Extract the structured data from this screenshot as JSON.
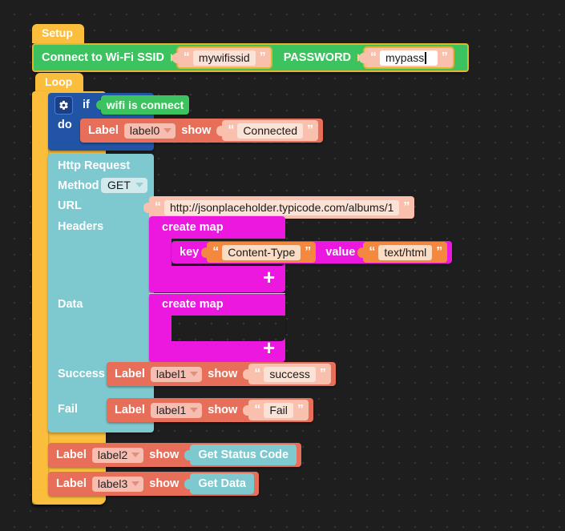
{
  "editor": {
    "background_color": "#1e1e1e",
    "grid_dot_color": "#3a3a3a"
  },
  "setup": {
    "tab_label": "Setup",
    "statement_label": "Connect to Wi-Fi SSID",
    "ssid_value": "mywifissid",
    "password_label": "PASSWORD",
    "password_value": "mypass",
    "color": "#3cc35f"
  },
  "loop": {
    "tab_label": "Loop",
    "color": "#fbbe3c"
  },
  "if_block": {
    "gear_icon": "gear-icon",
    "if_label": "if",
    "do_label": "do",
    "condition": "wifi is connect",
    "color": "#2254a5",
    "body": {
      "label_word": "Label",
      "label_target": "label0",
      "show_word": "show",
      "text_value": "Connected"
    }
  },
  "http_request": {
    "title": "Http Request",
    "color": "#7dc9cf",
    "rows": {
      "method_label": "Method",
      "method_value": "GET",
      "url_label": "URL",
      "url_value": "http://jsonplaceholder.typicode.com/albums/1",
      "headers_label": "Headers",
      "data_label": "Data",
      "success_label": "Success",
      "fail_label": "Fail"
    },
    "headers_map": {
      "create_map_label": "create map",
      "plus_label": "+",
      "entry": {
        "key_label": "key",
        "key_value": "Content-Type",
        "value_label": "value",
        "value_value": "text/html"
      }
    },
    "data_map": {
      "create_map_label": "create map",
      "plus_label": "+"
    },
    "success_statement": {
      "label_word": "Label",
      "label_target": "label1",
      "show_word": "show",
      "text_value": "success"
    },
    "fail_statement": {
      "label_word": "Label",
      "label_target": "label1",
      "show_word": "show",
      "text_value": "Fail"
    }
  },
  "bottom_statements": [
    {
      "label_word": "Label",
      "label_target": "label2",
      "show_word": "show",
      "value_block": "Get Status Code"
    },
    {
      "label_word": "Label",
      "label_target": "label3",
      "show_word": "show",
      "value_block": "Get Data"
    }
  ]
}
